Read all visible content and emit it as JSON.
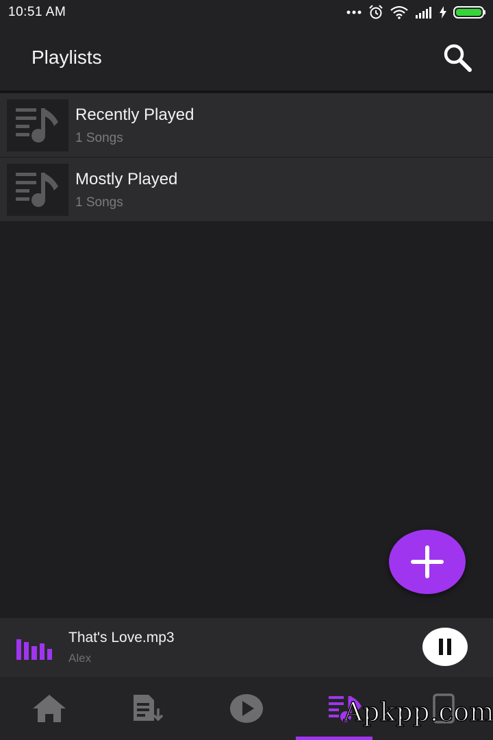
{
  "status_bar": {
    "time": "10:51 AM"
  },
  "app_bar": {
    "title": "Playlists",
    "search_icon": "search-icon"
  },
  "playlists": [
    {
      "name": "Recently Played",
      "count": "1 Songs"
    },
    {
      "name": "Mostly Played",
      "count": "1 Songs"
    }
  ],
  "fab": {
    "icon": "plus-icon"
  },
  "now_playing": {
    "title": "That's Love.mp3",
    "artist": "Alex",
    "state": "playing"
  },
  "bottom_nav": {
    "items": [
      {
        "icon": "home-icon",
        "active": false
      },
      {
        "icon": "download-list-icon",
        "active": false
      },
      {
        "icon": "play-circle-icon",
        "active": false
      },
      {
        "icon": "playlist-music-icon",
        "active": true
      },
      {
        "icon": "phone-icon",
        "active": false
      }
    ]
  },
  "watermark": "Apkpp.com",
  "colors": {
    "accent": "#a035f0",
    "background": "#1e1e20",
    "surface": "#2c2c2e"
  }
}
